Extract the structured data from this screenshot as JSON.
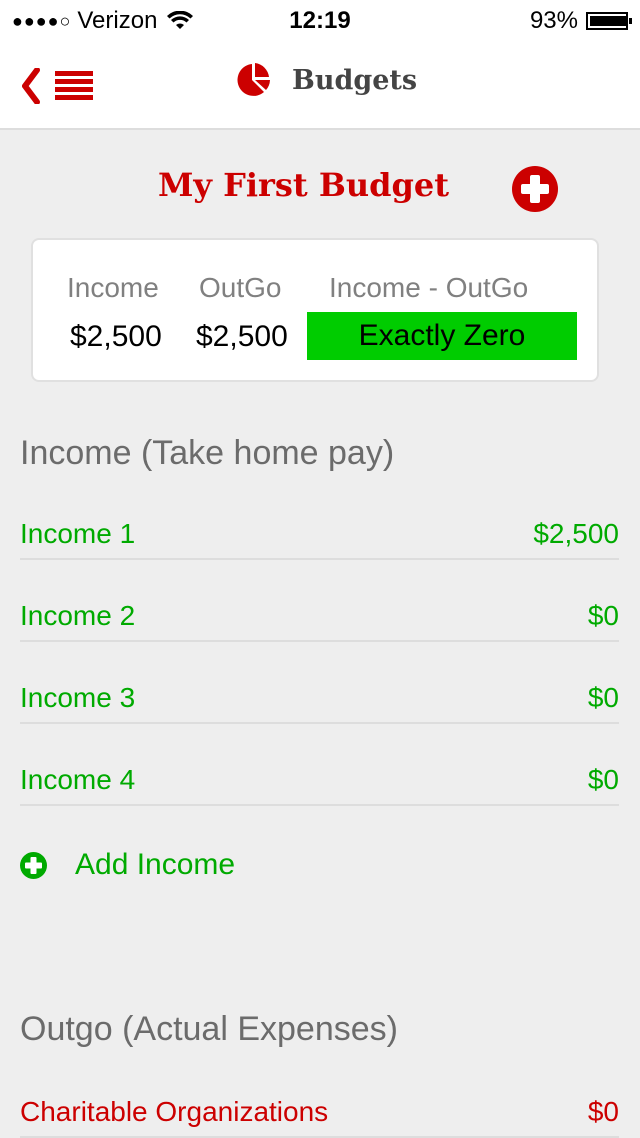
{
  "status_bar": {
    "signal": "●●●●○",
    "carrier": "Verizon",
    "time": "12:19",
    "battery": "93%",
    "battery_level": 0.93
  },
  "nav": {
    "title": "Budgets",
    "back_menu_icon": "back-menu-icon",
    "title_icon": "pie-chart-icon"
  },
  "budget": {
    "name": "My First Budget",
    "add_icon": "plus-circle-icon"
  },
  "summary": {
    "income_label": "Income",
    "outgo_label": "OutGo",
    "diff_label": "Income - OutGo",
    "income_value": "$2,500",
    "outgo_value": "$2,500",
    "diff_value": "Exactly Zero",
    "diff_color": "#00cc00"
  },
  "income_section": {
    "heading": "Income (Take home pay)",
    "color": "#00aa00",
    "items": [
      {
        "label": "Income 1",
        "amount": "$2,500"
      },
      {
        "label": "Income 2",
        "amount": "$0"
      },
      {
        "label": "Income 3",
        "amount": "$0"
      },
      {
        "label": "Income 4",
        "amount": "$0"
      }
    ],
    "add_label": "Add Income"
  },
  "outgo_section": {
    "heading": "Outgo (Actual Expenses)",
    "color": "#cc0000",
    "items": [
      {
        "label": "Charitable Organizations",
        "amount": "$0"
      }
    ]
  }
}
